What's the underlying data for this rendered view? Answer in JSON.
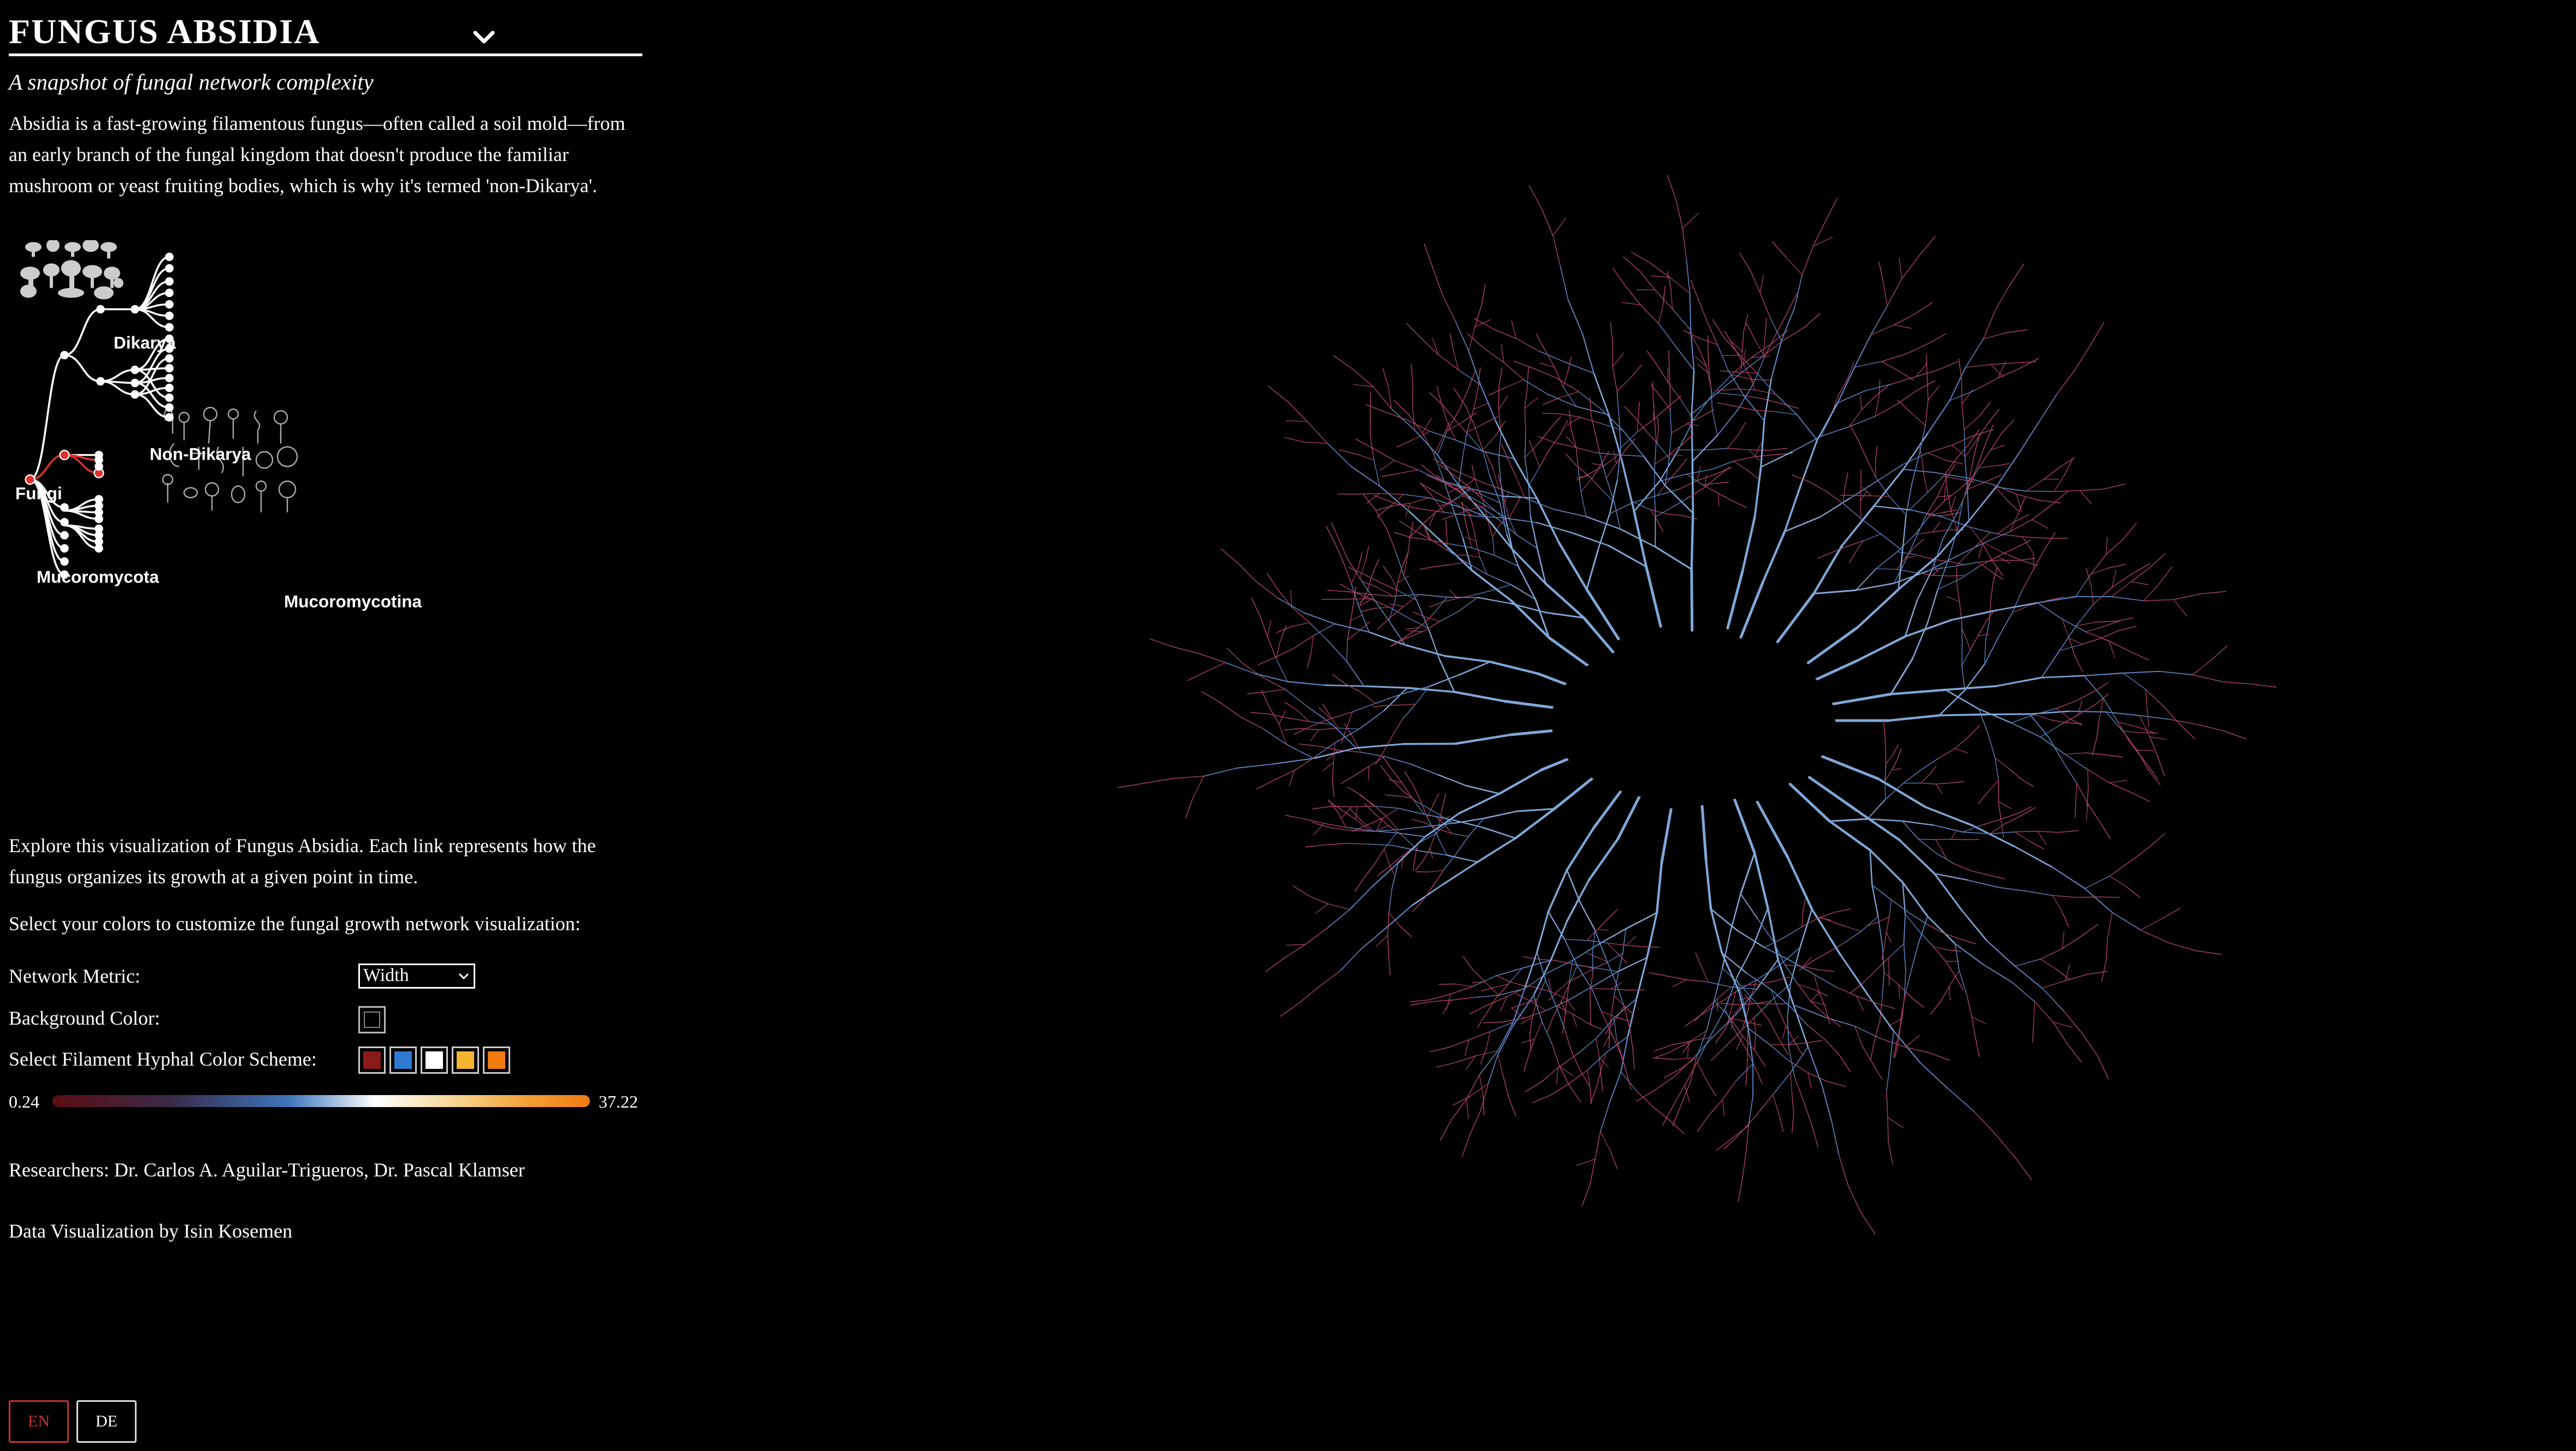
{
  "header": {
    "title": "FUNGUS  ABSIDIA",
    "subtitle": "A snapshot of fungal network complexity"
  },
  "intro": "Absidia is a fast-growing filamentous fungus—often called a soil mold—from an early branch of the fungal kingdom that doesn't produce the familiar mushroom or yeast fruiting bodies, which is why it's termed 'non-Dikarya'.",
  "tree": {
    "labels": {
      "fungi": "Fungi",
      "dikarya": "Dikarya",
      "non_dikarya": "Non-Dikarya",
      "mucoromycota": "Mucoromycota",
      "mucoromycotina": "Mucoromycotina"
    },
    "highlight_color": "#e0302b"
  },
  "explore": "Explore this visualization of Fungus Absidia. Each link represents how the fungus organizes its growth at a given point in time.",
  "select_prompt": "Select your colors to customize the fungal growth network visualization:",
  "controls": {
    "metric_label": "Network Metric:",
    "metric_value": "Width",
    "background_label": "Background Color:",
    "background_value": "#000000",
    "scheme_label": "Select Filament Hyphal Color Scheme:",
    "scheme_colors": [
      "#8b1a1a",
      "#2f7ad0",
      "#ffffff",
      "#f5b531",
      "#f07b11"
    ]
  },
  "legend": {
    "min": "0.24",
    "max": "37.22"
  },
  "credits": {
    "researchers": "Researchers: Dr. Carlos A. Aguilar-Trigueros, Dr. Pascal Klamser",
    "dataviz": "Data Visualization by Isin Kosemen"
  },
  "language": {
    "en": "EN",
    "de": "DE",
    "active": "EN"
  },
  "network": {
    "trunk_color": "#7fa8d8",
    "branch_color": "#5a86c4",
    "tip_color": "#b04466",
    "background": "#000000"
  }
}
